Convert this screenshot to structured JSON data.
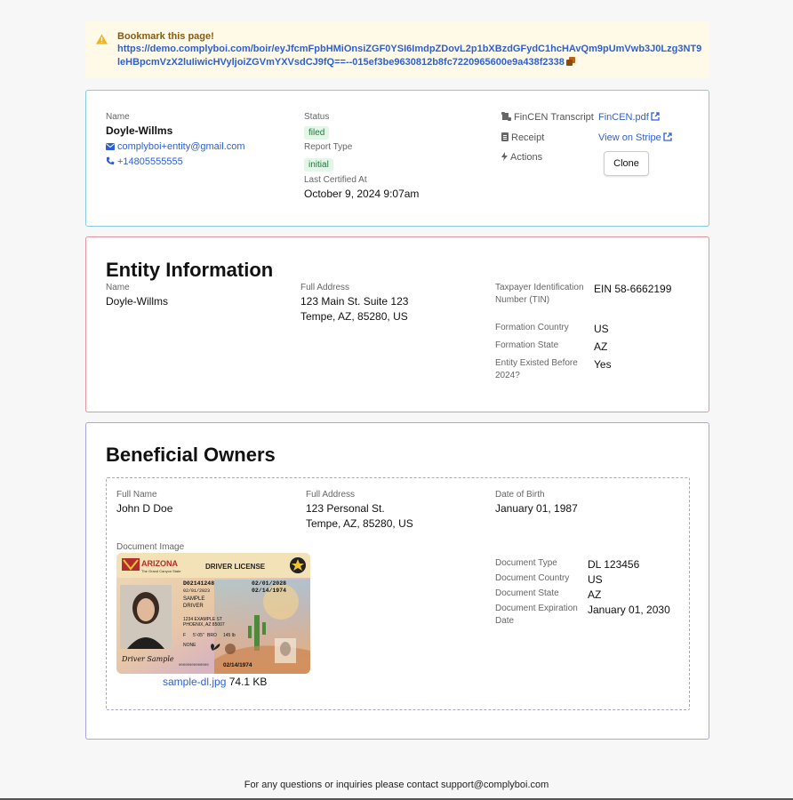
{
  "banner": {
    "title": "Bookmark this page!",
    "url": "https://demo.complyboi.com/boir/eyJfcmFpbHMiOnsiZGF0YSI6ImdpZDovL2p1bXBzdGFydC1hcHAvQm9pUmVwb3J0Lzg3NT9leHBpcmVzX2luIiwicHVyljoiZGVmYXVsdCJ9fQ==--015ef3be9630812b8fc7220965600e9a438f2338",
    "copy_icon": "copy-icon",
    "warn_icon": "warning-icon",
    "warn_color": "#f0b41c"
  },
  "summary": {
    "name_label": "Name",
    "name": "Doyle-Willms",
    "email": "complyboi+entity@gmail.com",
    "phone": "+14805555555",
    "status_label": "Status",
    "status": "filed",
    "report_type_label": "Report Type",
    "report_type": "initial",
    "certified_label": "Last Certified At",
    "certified": "October 9, 2024 9:07am",
    "fincen_label": "FinCEN Transcript",
    "fincen_link": "FinCEN.pdf",
    "receipt_label": "Receipt",
    "receipt_link": "View on Stripe",
    "actions_label": "Actions",
    "clone_button": "Clone"
  },
  "entity": {
    "heading": "Entity Information",
    "name_label": "Name",
    "name": "Doyle-Willms",
    "address_label": "Full Address",
    "address_line1": "123 Main St. Suite 123",
    "address_line2": "Tempe, AZ, 85280, US",
    "tin_label": "Taxpayer Identification Number (TIN)",
    "tin": "EIN 58-6662199",
    "country_label": "Formation Country",
    "country": "US",
    "state_label": "Formation State",
    "state": "AZ",
    "existed_label": "Entity Existed Before 2024?",
    "existed": "Yes"
  },
  "owners": {
    "heading": "Beneficial Owners",
    "items": [
      {
        "name_label": "Full Name",
        "name": "John D Doe",
        "address_label": "Full Address",
        "address_line1": "123 Personal St.",
        "address_line2": "Tempe, AZ, 85280, US",
        "dob_label": "Date of Birth",
        "dob": "January 01, 1987",
        "doc_image_label": "Document Image",
        "doc_file": "sample-dl.jpg",
        "doc_size": "74.1 KB",
        "doc_type_label": "Document Type",
        "doc_type": "DL 123456",
        "doc_country_label": "Document Country",
        "doc_country": "US",
        "doc_state_label": "Document State",
        "doc_state": "AZ",
        "doc_exp_label": "Document Expiration Date",
        "doc_exp": "January 01, 2030",
        "card": {
          "state": "ARIZONA",
          "motto": "The Grand Canyon State",
          "type": "DRIVER LICENSE",
          "dl_no": "D02141248",
          "exp": "02/01/2028",
          "iss": "02/01/2023",
          "dob": "02/14/1974",
          "last": "SAMPLE",
          "first": "DRIVER",
          "street": "1234 EXAMPLE ST",
          "city": "PHOENIX, AZ 85007",
          "sex": "F",
          "hgt": "5'-05\"",
          "eyes": "BRO",
          "wgt": "145 lb",
          "rest": "NONE",
          "signature": "Driver Sample",
          "number_strip": "00000000000000",
          "dob_small": "02/14/1974"
        }
      }
    ]
  },
  "footer": {
    "text": "For any questions or inquiries please contact support@complyboi.com"
  }
}
